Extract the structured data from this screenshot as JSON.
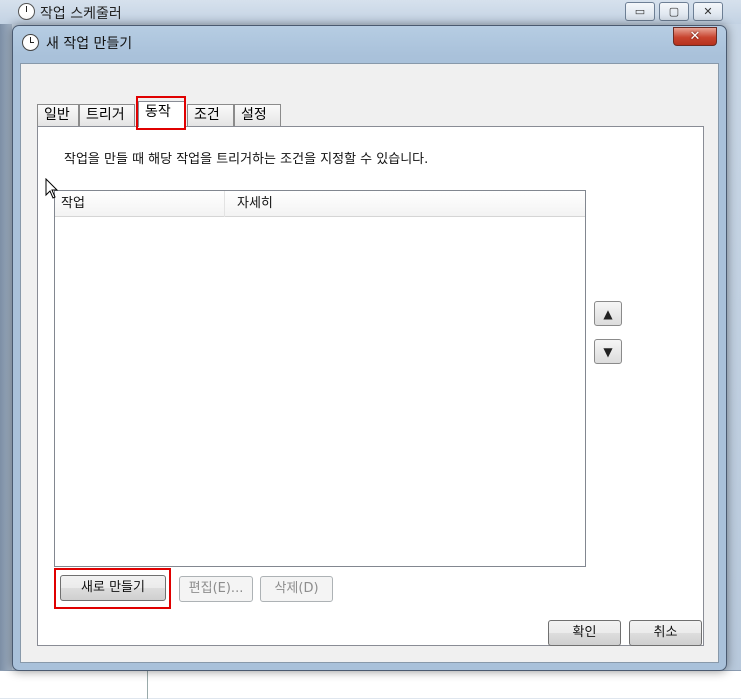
{
  "app": {
    "title": "작업 스케줄러",
    "controls": [
      "▭",
      "▢",
      "✕"
    ]
  },
  "dialog": {
    "title": "새 작업 만들기",
    "close_label": "✕"
  },
  "tabs": [
    {
      "label": "일반",
      "active": false
    },
    {
      "label": "트리거",
      "active": false
    },
    {
      "label": "동작",
      "active": true
    },
    {
      "label": "조건",
      "active": false
    },
    {
      "label": "설정",
      "active": false
    }
  ],
  "panel": {
    "description": "작업을 만들 때 해당 작업을 트리거하는 조건을 지정할 수 있습니다.",
    "columns": [
      "작업",
      "자세히"
    ],
    "rows": [],
    "move_up_label": "▲",
    "move_down_label": "▼",
    "new_label": "새로 만들기",
    "edit_label": "편집(E)...",
    "delete_label": "삭제(D)"
  },
  "footer": {
    "ok_label": "확인",
    "cancel_label": "취소"
  },
  "colors": {
    "highlight": "#e00000",
    "close_button": "#c8442f"
  }
}
